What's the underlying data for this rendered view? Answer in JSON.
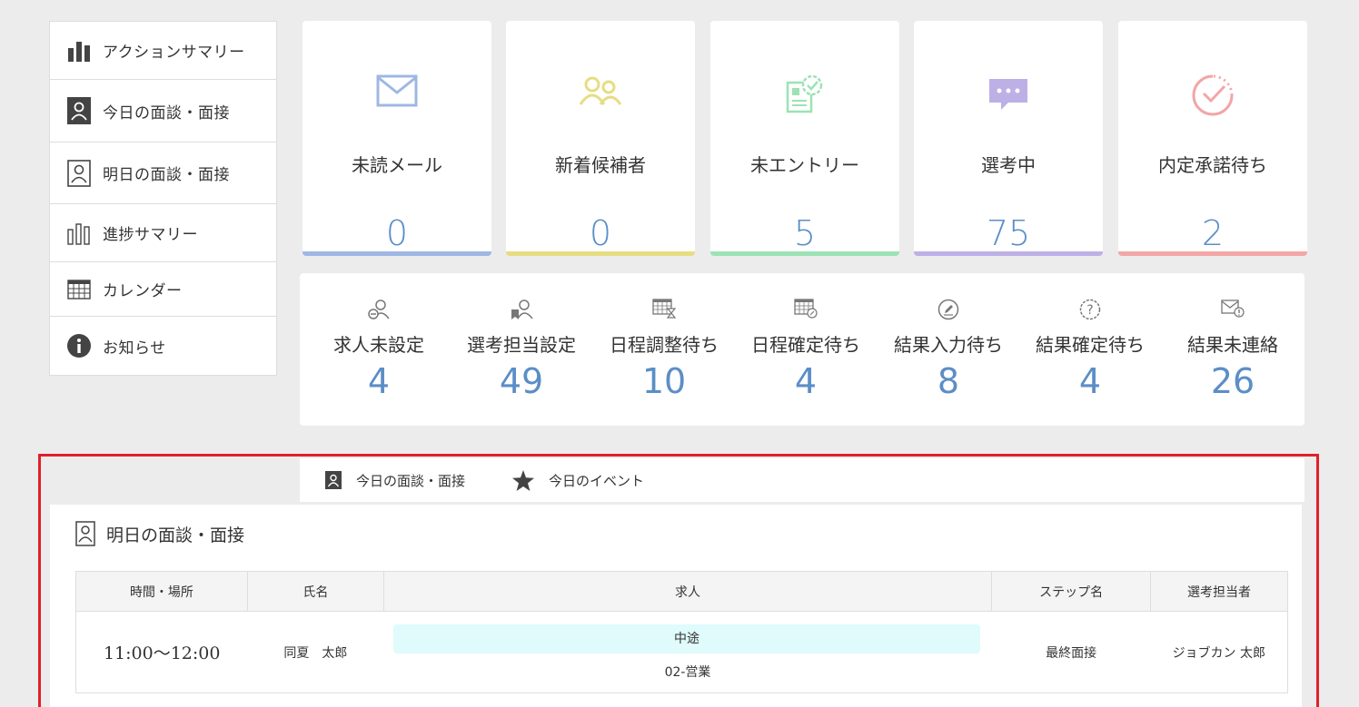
{
  "sidebar": {
    "items": [
      {
        "label": "アクションサマリー",
        "icon": "bar-chart-icon"
      },
      {
        "label": "今日の面談・面接",
        "icon": "person-badge-filled-icon"
      },
      {
        "label": "明日の面談・面接",
        "icon": "person-badge-outline-icon"
      },
      {
        "label": "進捗サマリー",
        "icon": "progress-bars-icon"
      },
      {
        "label": "カレンダー",
        "icon": "calendar-icon"
      },
      {
        "label": "お知らせ",
        "icon": "info-icon"
      }
    ]
  },
  "cards": [
    {
      "label": "未読メール",
      "value": "0",
      "icon": "mail-icon",
      "color": "#9fb7e3"
    },
    {
      "label": "新着候補者",
      "value": "0",
      "icon": "people-icon",
      "color": "#e6dd83"
    },
    {
      "label": "未エントリー",
      "value": "5",
      "icon": "document-check-icon",
      "color": "#9be3b4"
    },
    {
      "label": "選考中",
      "value": "75",
      "icon": "chat-bubble-icon",
      "color": "#bdb0e6"
    },
    {
      "label": "内定承諾待ち",
      "value": "2",
      "icon": "check-circle-icon",
      "color": "#f2a6a6"
    }
  ],
  "stats": [
    {
      "label": "求人未設定",
      "value": "4",
      "icon": "person-minus-icon"
    },
    {
      "label": "選考担当設定",
      "value": "49",
      "icon": "person-bookmark-icon"
    },
    {
      "label": "日程調整待ち",
      "value": "10",
      "icon": "calendar-hourglass-icon"
    },
    {
      "label": "日程確定待ち",
      "value": "4",
      "icon": "calendar-pending-icon"
    },
    {
      "label": "結果入力待ち",
      "value": "8",
      "icon": "pen-circle-icon"
    },
    {
      "label": "結果確定待ち",
      "value": "4",
      "icon": "question-circle-icon"
    },
    {
      "label": "結果未連絡",
      "value": "26",
      "icon": "mail-alert-icon"
    }
  ],
  "tabs": [
    {
      "label": "今日の面談・面接",
      "icon": "person-badge-filled-icon"
    },
    {
      "label": "今日のイベント",
      "icon": "star-icon"
    }
  ],
  "panel": {
    "title": "明日の面談・面接",
    "columns": [
      "時間・場所",
      "氏名",
      "求人",
      "ステップ名",
      "選考担当者"
    ],
    "rows": [
      {
        "time": "11:00〜12:00",
        "name": "同夏　太郎",
        "job_type": "中途",
        "job_name": "02-営業",
        "step": "最終面接",
        "owner": "ジョブカン 太郎"
      }
    ]
  },
  "colors": {
    "accent_value": "#5b8ec7",
    "highlight_border": "#e0202a"
  }
}
